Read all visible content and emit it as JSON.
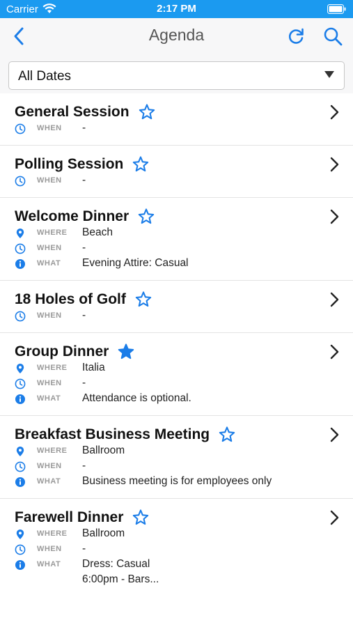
{
  "status_bar": {
    "carrier": "Carrier",
    "time": "2:17 PM"
  },
  "nav": {
    "title": "Agenda"
  },
  "filter": {
    "selected": "All Dates"
  },
  "labels": {
    "where": "WHERE",
    "when": "WHEN",
    "what": "WHAT"
  },
  "colors": {
    "accent": "#1b7de8",
    "status_bar": "#1b9af0"
  },
  "items": [
    {
      "title": "General Session",
      "favorite": false,
      "when": "-"
    },
    {
      "title": "Polling Session",
      "favorite": false,
      "when": "-"
    },
    {
      "title": "Welcome Dinner",
      "favorite": false,
      "where": "Beach",
      "when": "-",
      "what": "Evening Attire: Casual"
    },
    {
      "title": "18 Holes of Golf",
      "favorite": false,
      "when": "-"
    },
    {
      "title": "Group Dinner",
      "favorite": true,
      "where": "Italia",
      "when": "-",
      "what": "Attendance is optional."
    },
    {
      "title": "Breakfast Business Meeting",
      "favorite": false,
      "where": "Ballroom",
      "when": "-",
      "what": "Business meeting is for employees only"
    },
    {
      "title": "Farewell Dinner",
      "favorite": false,
      "where": "Ballroom",
      "when": "-",
      "what": "Dress: Casual",
      "what_line2": "6:00pm - Bars..."
    }
  ]
}
